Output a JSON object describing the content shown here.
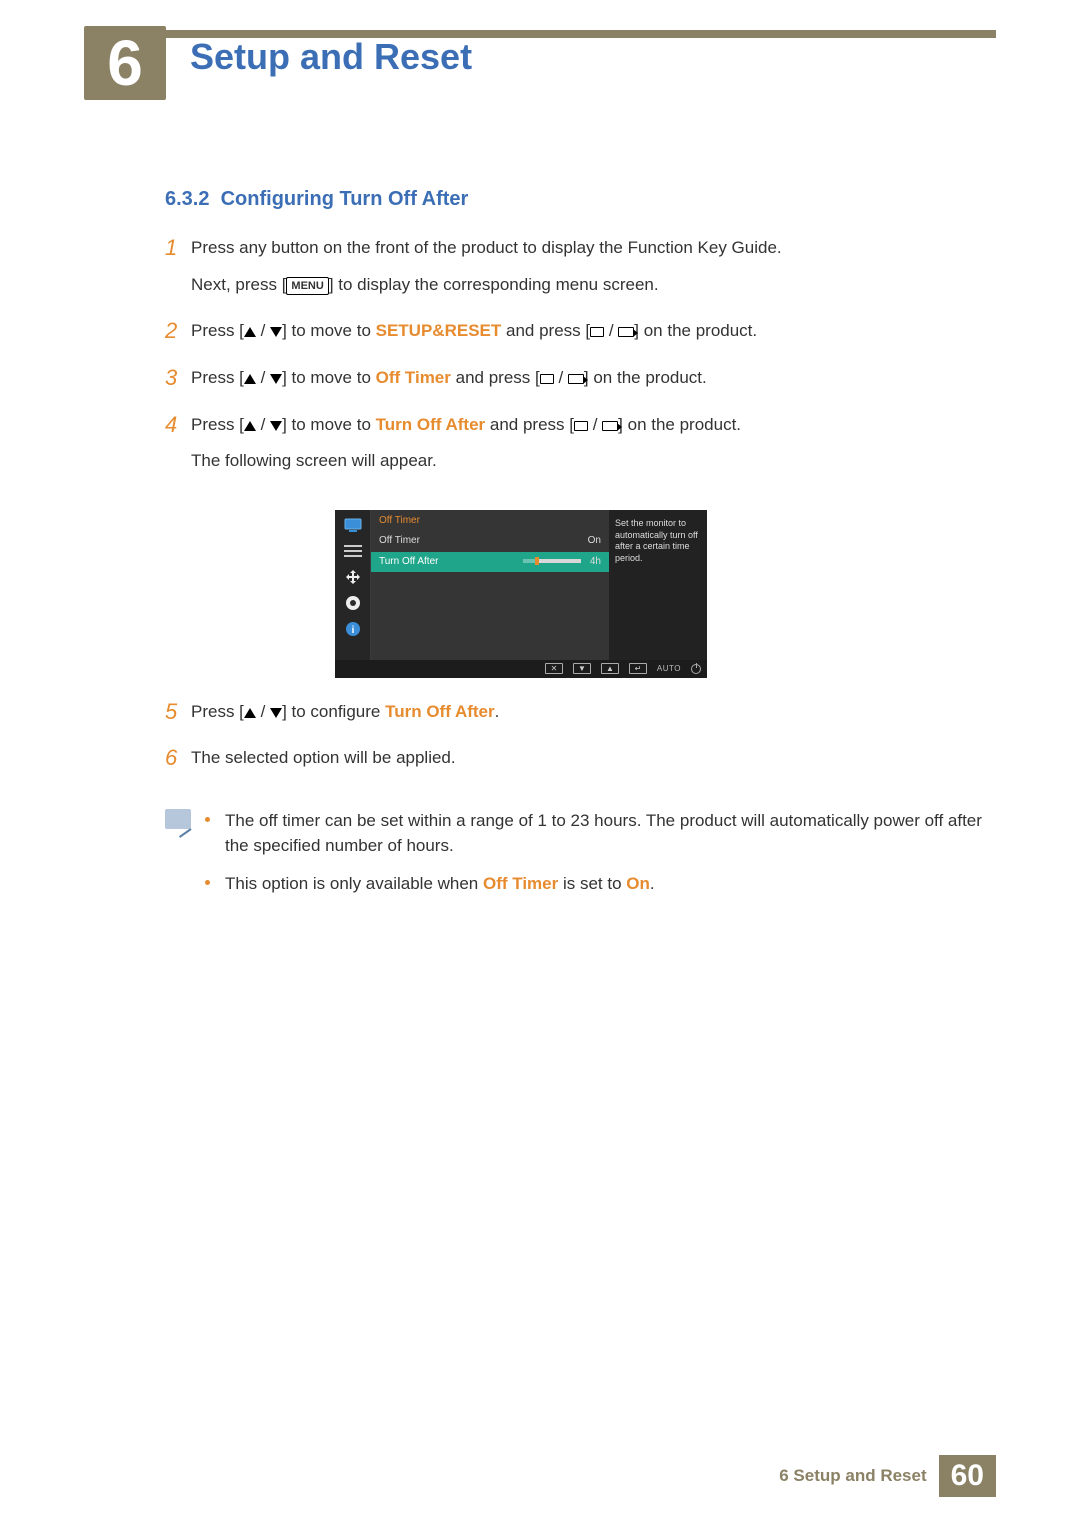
{
  "chapter": {
    "number": "6",
    "title": "Setup and Reset"
  },
  "section": {
    "number": "6.3.2",
    "title": "Configuring Turn Off After"
  },
  "steps": {
    "s1": {
      "num": "1",
      "line1_a": "Press any button on the front of the product to display the Function Key Guide.",
      "line2_a": "Next, press [",
      "menu_key": "MENU",
      "line2_b": "] to display the corresponding menu screen."
    },
    "s2": {
      "num": "2",
      "pre": "Press [",
      "mid": "] to move to ",
      "target": "SETUP&RESET",
      "post1": " and press [",
      "post2": "] on the product."
    },
    "s3": {
      "num": "3",
      "pre": "Press [",
      "mid": "] to move to ",
      "target": "Off Timer",
      "post1": " and press [",
      "post2": "] on the product."
    },
    "s4": {
      "num": "4",
      "pre": "Press [",
      "mid": "] to move to ",
      "target": "Turn Off After",
      "post1": " and press [",
      "post2": "] on the product.",
      "trailer": "The following screen will appear."
    },
    "s5": {
      "num": "5",
      "pre": "Press [",
      "mid": "] to configure ",
      "target": "Turn Off After",
      "post": "."
    },
    "s6": {
      "num": "6",
      "text": "The selected option will be applied."
    }
  },
  "osd": {
    "title": "Off Timer",
    "row1": {
      "label": "Off Timer",
      "value": "On"
    },
    "row2": {
      "label": "Turn Off After",
      "value": "4h"
    },
    "help": "Set the monitor to automatically turn off after a certain time period.",
    "footer_auto": "AUTO"
  },
  "notes": {
    "n1": "The off timer can be set within a range of 1 to 23 hours. The product will automatically power off after the specified number of hours.",
    "n2_a": "This option is only available when ",
    "n2_b": "Off Timer",
    "n2_c": " is set to ",
    "n2_d": "On",
    "n2_e": "."
  },
  "footer": {
    "text": "6 Setup and Reset",
    "page": "60"
  }
}
